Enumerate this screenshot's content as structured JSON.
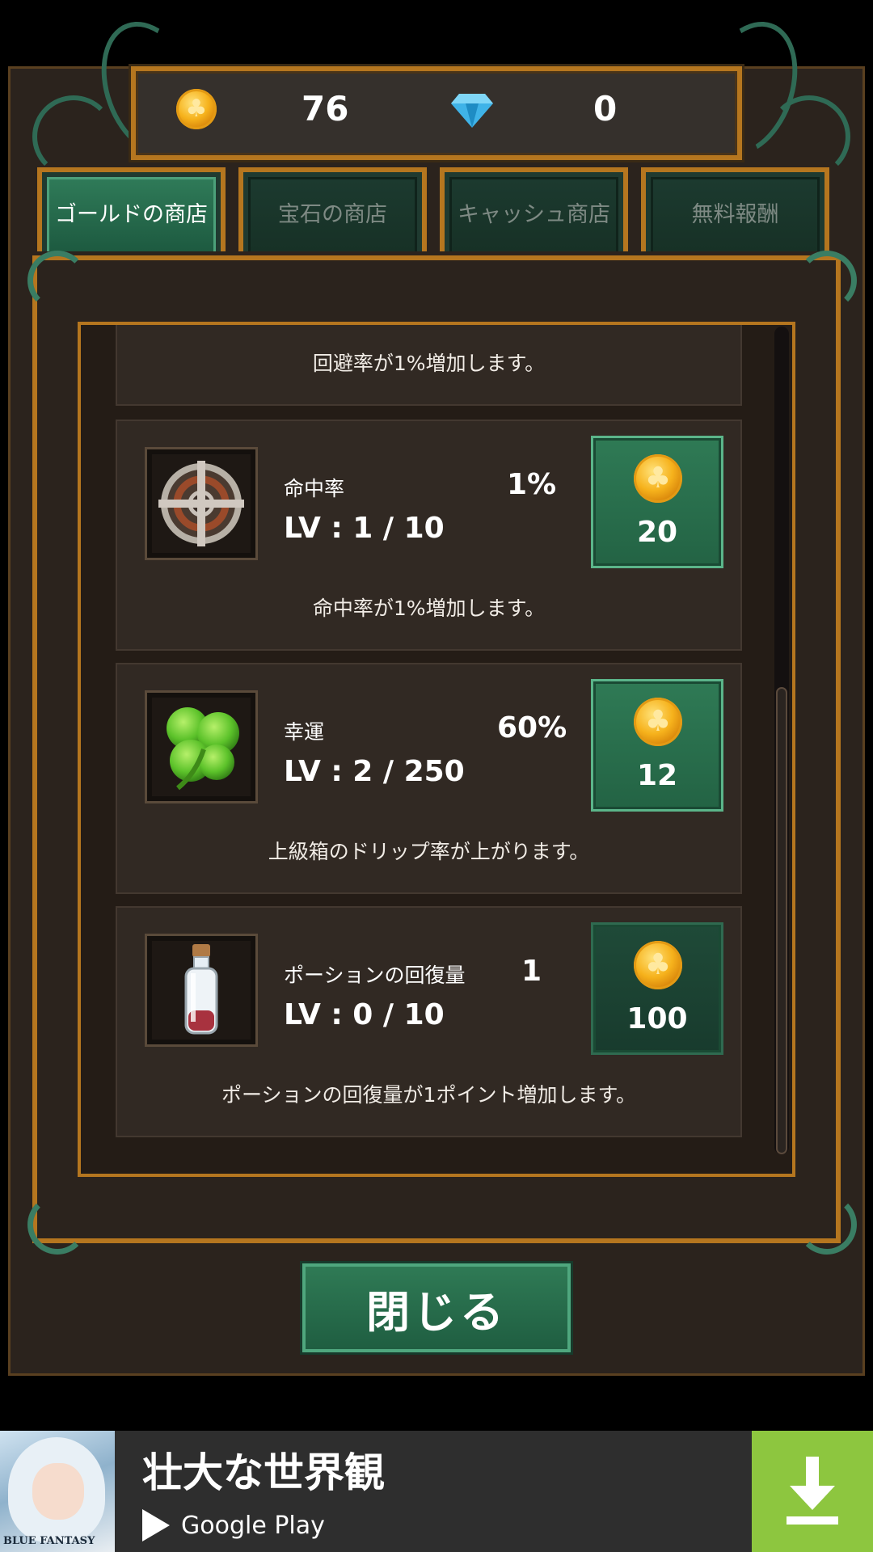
{
  "currency": {
    "gold_icon": "gold-coin-icon",
    "gold": "76",
    "gem_icon": "diamond-icon",
    "gems": "0"
  },
  "tabs": [
    {
      "label": "ゴールドの商店",
      "active": true
    },
    {
      "label": "宝石の商店",
      "active": false
    },
    {
      "label": "キャッシュ商店",
      "active": false
    },
    {
      "label": "無料報酬",
      "active": false
    }
  ],
  "items": [
    {
      "desc": "回避率が1%増加します。"
    },
    {
      "icon": "crosshair-icon",
      "name": "命中率",
      "value": "1%",
      "level": "LV : 1 / 10",
      "price": "20",
      "price_icon": "gold-coin-icon",
      "desc": "命中率が1%増加します。"
    },
    {
      "icon": "clover-icon",
      "name": "幸運",
      "value": "60%",
      "level": "LV : 2 / 250",
      "price": "12",
      "price_icon": "gold-coin-icon",
      "desc": "上級箱のドリップ率が上がります。"
    },
    {
      "icon": "potion-icon",
      "name": "ポーションの回復量",
      "value": "1",
      "level": "LV : 0 / 10",
      "price": "100",
      "price_icon": "gold-coin-icon",
      "desc": "ポーションの回復量が1ポイント増加します。"
    }
  ],
  "close_label": "閉じる",
  "ad": {
    "thumb_text": "BLUE FANTASY",
    "title": "壮大な世界観",
    "store": "Google Play",
    "download_icon": "download-icon"
  },
  "colors": {
    "frame_gold": "#b5761f",
    "button_green": "#2f7a55",
    "panel_brown": "#2b231d",
    "ad_green": "#8dc63f"
  }
}
